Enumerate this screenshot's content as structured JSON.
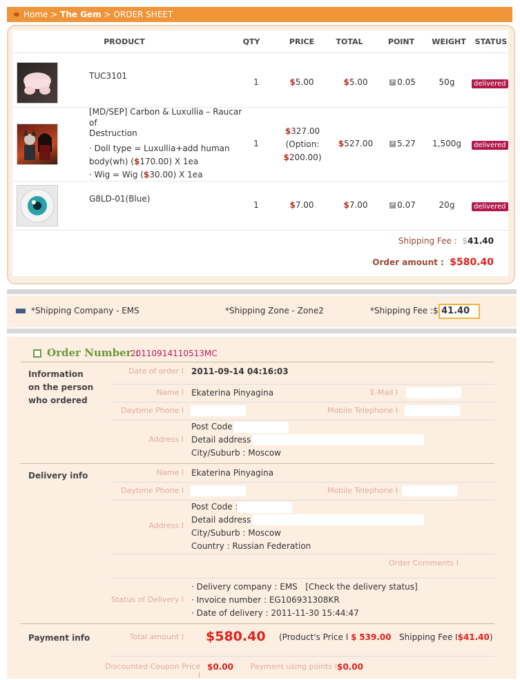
{
  "breadcrumb": {
    "home": "Home",
    "sep1": ">",
    "category": "The Gem",
    "sep2": ">",
    "page": "ORDER SHEET"
  },
  "table": {
    "headers": {
      "product": "PRODUCT",
      "qty": "QTY",
      "price": "PRICE",
      "total": "TOTAL",
      "point": "POINT",
      "weight": "WEIGHT",
      "status": "STATUS"
    },
    "rows": [
      {
        "name": "TUC3101",
        "qty": "1",
        "price": "5.00",
        "total": "5.00",
        "point": "0.05",
        "weight": "50g",
        "status": "delivered",
        "thumb": "pink-bloomers"
      },
      {
        "name_line1": "[MD/SEP] Carbon & Luxullia – Raucar of",
        "name_line2": "Destruction",
        "option1_a": "· Doll type = Luxullia+add human",
        "option1_b": "body(wh) (",
        "option1_price": "170.00",
        "option1_c": ") X 1ea",
        "option2_a": "· Wig = Wig (",
        "option2_price": "30.00",
        "option2_c": ") X 1ea",
        "qty": "1",
        "price": "327.00",
        "option_label": "(Option:",
        "option_price": "200.00",
        "option_close": ")",
        "total": "527.00",
        "point": "5.27",
        "weight": "1,500g",
        "status": "delivered",
        "thumb": "doll-pair"
      },
      {
        "name": "G8LD-01(Blue)",
        "qty": "1",
        "price": "7.00",
        "total": "7.00",
        "point": "0.07",
        "weight": "20g",
        "status": "delivered",
        "thumb": "blue-eye"
      }
    ],
    "currency": "$",
    "shipping_fee_label": "Shipping Fee :",
    "shipping_fee": "41.40",
    "order_amount_label": "Order amount :",
    "order_amount": "580.40"
  },
  "shipping_strip": {
    "company": "*Shipping Company - EMS",
    "zone": "*Shipping Zone - Zone2",
    "fee_label": "*Shipping Fee :",
    "fee_value": "41.40"
  },
  "order": {
    "number_label": "Order Number :",
    "number": "20110914110513MC",
    "orderer": {
      "section_line1": "Information",
      "section_line2": "on the person",
      "section_line3": "who ordered",
      "date_label": "Date of order I",
      "date": "2011-09-14 04:16:03",
      "name_label": "Name I",
      "name": "Ekaterina Pinyagina",
      "email_label": "E-Mail I",
      "daytime_label": "Daytime Phone I",
      "mobile_label": "Mobile Telephone I",
      "address_label": "Address I",
      "post_code": "Post Code :",
      "detail_address": "Detail address :",
      "city": "City/Suburb : Moscow"
    },
    "delivery": {
      "section": "Delivery info",
      "name_label": "Name I",
      "name": "Ekaterina Pinyagina",
      "daytime_label": "Daytime Phone I",
      "mobile_label": "Mobile Telephone I",
      "address_label": "Address I",
      "post_code": "Post Code :",
      "detail_address": "Detail address :",
      "city": "City/Suburb : Moscow",
      "country": "Country : Russian Federation",
      "comments_label": "Order Comments I",
      "status_label": "Status of Delivery I",
      "company": "· Delivery company : EMS",
      "check_link": "[Check the delivery status]",
      "invoice": "· Invoice number : EG106931308KR",
      "date": "· Date of delivery : 2011-11-30 15:44:47"
    },
    "payment": {
      "section": "Payment info",
      "total_label": "Total amount I",
      "total": "580.40",
      "product_price_label": "(Product's Price I",
      "product_price": "539.00",
      "shipping_label": "Shipping Fee I",
      "shipping": "41.40",
      "close": ")",
      "coupon_label": "Discounted Coupon Price I",
      "coupon": "0.00",
      "points_label": "Payment using points I",
      "points": "0.00"
    }
  },
  "colors": {
    "accent": "#f0943a",
    "price_red": "#e0211b",
    "badge": "#b21a4b",
    "label_pink": "#e0a9a2",
    "order_number": "#c2185b",
    "order_title": "#6a9a3a"
  }
}
